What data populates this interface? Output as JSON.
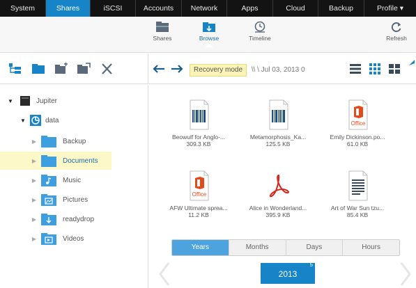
{
  "topnav": {
    "tabs": [
      {
        "label": "System",
        "active": false
      },
      {
        "label": "Shares",
        "active": true
      },
      {
        "label": "iSCSI",
        "active": false
      },
      {
        "label": "Accounts",
        "active": false
      },
      {
        "label": "Network",
        "active": false
      },
      {
        "label": "Apps",
        "active": false
      },
      {
        "label": "Cloud",
        "active": false
      },
      {
        "label": "Backup",
        "active": false
      },
      {
        "label": "Profile ▾",
        "active": false
      }
    ]
  },
  "subbar": {
    "shares_label": "Shares",
    "browse_label": "Browse",
    "timeline_label": "Timeline",
    "refresh_label": "Refresh"
  },
  "toolbar": {
    "recovery_mode": "Recovery mode",
    "path": "\\\\ \\ Jul 03, 2013 0"
  },
  "tree": {
    "root": "Jupiter",
    "volume": "data",
    "folders": [
      {
        "label": "Backup"
      },
      {
        "label": "Documents"
      },
      {
        "label": "Music"
      },
      {
        "label": "Pictures"
      },
      {
        "label": "readydrop"
      },
      {
        "label": "Videos"
      }
    ]
  },
  "files": [
    {
      "name": "Beowulf for Anglo-...",
      "size": "309.3 KB",
      "icon": "barcode-doc-icon"
    },
    {
      "name": "Metamorphosis_Ka...",
      "size": "125.5 KB",
      "icon": "barcode-doc-icon"
    },
    {
      "name": "Emily Dickinson.po...",
      "size": "61.0 KB",
      "icon": "office-doc-icon"
    },
    {
      "name": "AFW Ultimate sprea...",
      "size": "11.2 KB",
      "icon": "office-doc-icon"
    },
    {
      "name": "Alice in Wonderland...",
      "size": "395.9 KB",
      "icon": "pdf-doc-icon"
    },
    {
      "name": "Art of War Sun tzu...",
      "size": "85.4 KB",
      "icon": "text-doc-icon"
    }
  ],
  "timeline": {
    "segments": [
      "Years",
      "Months",
      "Days",
      "Hours"
    ],
    "active_segment": "Years",
    "year": "2013",
    "year_badge": "5"
  },
  "colors": {
    "nav_bg": "#131313",
    "accent": "#1784c7",
    "selected_row": "#fdf8c8",
    "office_orange": "#e34b1a",
    "pdf_red": "#d42a1e"
  }
}
